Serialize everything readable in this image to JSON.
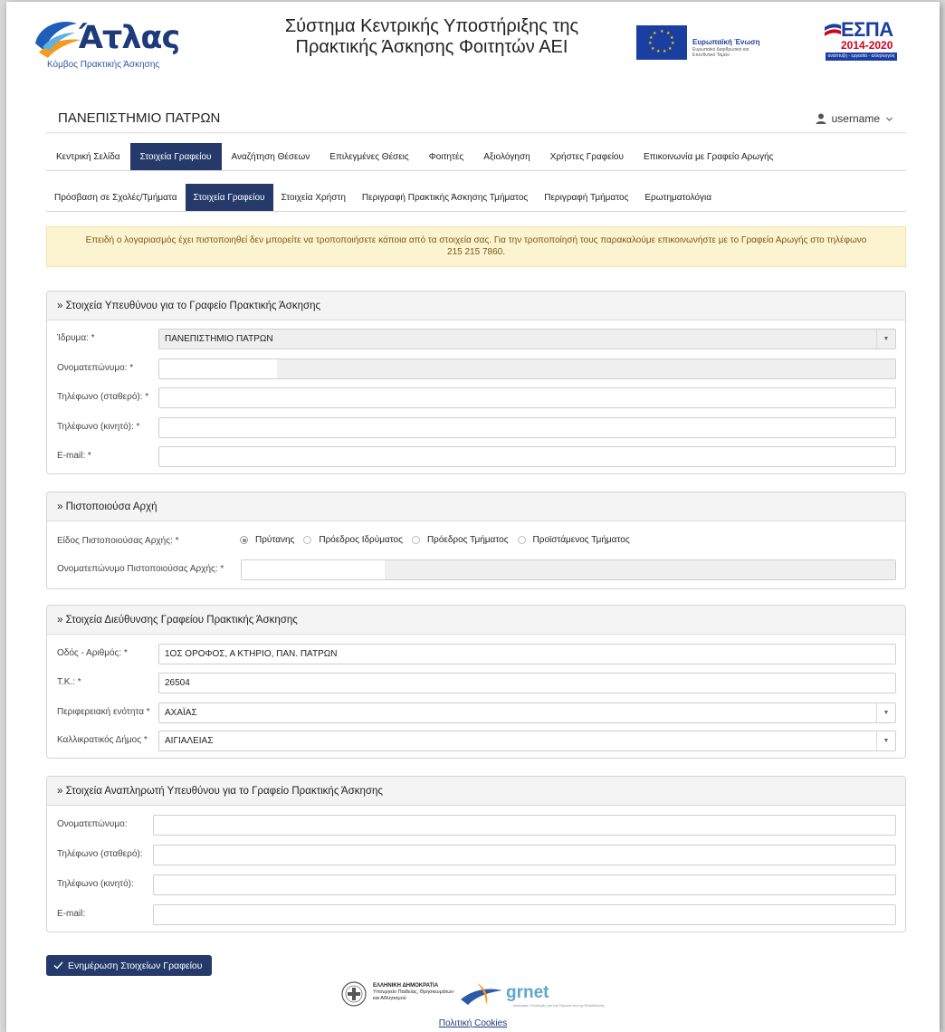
{
  "header": {
    "logo_title": "Άτλας",
    "logo_subtitle": "Κόμβος Πρακτικής Άσκησης",
    "system_title_line1": "Σύστημα Κεντρικής Υποστήριξης της",
    "system_title_line2": "Πρακτικής Άσκησης Φοιτητών ΑΕΙ",
    "eu_name": "Ευρωπαϊκή Ένωση",
    "eu_sub": "Ευρωπαϊκό Διαρθρωτικό και Επενδυτικό Ταμείο",
    "espa_title": "ΕΣΠΑ",
    "espa_years": "2014-2020",
    "espa_strip": "ανάπτυξη - εργασία - αλληλεγγύη"
  },
  "topbar": {
    "institution": "ΠΑΝΕΠΙΣΤΗΜΙΟ ΠΑΤΡΩΝ",
    "username": "username"
  },
  "nav_main": [
    {
      "label": "Κεντρική Σελίδα",
      "active": false
    },
    {
      "label": "Στοιχεία Γραφείου",
      "active": true
    },
    {
      "label": "Αναζήτηση Θέσεων",
      "active": false
    },
    {
      "label": "Επιλεγμένες Θέσεις",
      "active": false
    },
    {
      "label": "Φοιτητές",
      "active": false
    },
    {
      "label": "Αξιολόγηση",
      "active": false
    },
    {
      "label": "Χρήστες Γραφείου",
      "active": false
    },
    {
      "label": "Επικοινωνία με Γραφείο Αρωγής",
      "active": false
    }
  ],
  "nav_sub": [
    {
      "label": "Πρόσβαση σε Σχολές/Τμήματα",
      "active": false
    },
    {
      "label": "Στοιχεία Γραφείου",
      "active": true
    },
    {
      "label": "Στοιχεία Χρήστη",
      "active": false
    },
    {
      "label": "Περιγραφή Πρακτικής Άσκησης Τμήματος",
      "active": false
    },
    {
      "label": "Περιγραφή Τμήματος",
      "active": false
    },
    {
      "label": "Ερωτηματολόγια",
      "active": false
    }
  ],
  "alert": {
    "text": "Επειδή ο λογαριασμός έχει πιστοποιηθεί δεν μπορείτε να τροποποιήσετε κάποια από τα στοιχεία σας. Για την τροποποίησή τους παρακαλούμε επικοινωνήστε με το Γραφείο Αρωγής στο τηλέφωνο 215 215 7860."
  },
  "panel_responsible": {
    "title": "» Στοιχεία Υπευθύνου για το Γραφείο Πρακτικής Άσκησης",
    "institution_label": "Ίδρυμα: *",
    "institution_value": "ΠΑΝΕΠΙΣΤΗΜΙΟ ΠΑΤΡΩΝ",
    "fullname_label": "Ονοματεπώνυμο: *",
    "fullname_value": "",
    "phone_fixed_label": "Τηλέφωνο (σταθερό): *",
    "phone_fixed_value": "",
    "phone_mobile_label": "Τηλέφωνο (κινητό): *",
    "phone_mobile_value": "",
    "email_label": "E-mail: *",
    "email_value": ""
  },
  "panel_authority": {
    "title": "» Πιστοποιούσα Αρχή",
    "type_label": "Είδος Πιστοποιούσας Αρχής: *",
    "options": [
      {
        "label": "Πρύτανης",
        "selected": true
      },
      {
        "label": "Πρόεδρος Ιδρύματος",
        "selected": false
      },
      {
        "label": "Πρόεδρος Τμήματος",
        "selected": false
      },
      {
        "label": "Προϊστάμενος Τμήματος",
        "selected": false
      }
    ],
    "name_label": "Ονοματεπώνυμο Πιστοποιούσας Αρχής: *",
    "name_value": ""
  },
  "panel_address": {
    "title": "» Στοιχεία Διεύθυνσης Γραφείου Πρακτικής Άσκησης",
    "street_label": "Οδός - Αριθμός: *",
    "street_value": "1ΟΣ ΟΡΟΦΟΣ, Α ΚΤΗΡΙΟ, ΠΑΝ. ΠΑΤΡΩΝ",
    "zip_label": "Τ.Κ.: *",
    "zip_value": "26504",
    "region_label": "Περιφερειακή ενότητα *",
    "region_value": "ΑΧΑΪΑΣ",
    "municipality_label": "Καλλικρατικός Δήμος *",
    "municipality_value": "ΑΙΓΙΑΛΕΙΑΣ"
  },
  "panel_deputy": {
    "title": "» Στοιχεία Αναπληρωτή Υπευθύνου για το Γραφείο Πρακτικής Άσκησης",
    "fullname_label": "Ονοματεπώνυμο:",
    "phone_fixed_label": "Τηλέφωνο (σταθερό):",
    "phone_mobile_label": "Τηλέφωνο (κινητό):",
    "email_label": "E-mail:"
  },
  "actions": {
    "submit_label": "Ενημέρωση Στοιχείων Γραφείου"
  },
  "footer": {
    "gov_line1": "ΕΛΛΗΝΙΚΗ ΔΗΜΟΚΡΑΤΙΑ",
    "gov_line2": "Υπουργείο Παιδείας, Θρησκευμάτων και Αθλητισμού",
    "grnet": "grnet",
    "grnet_sub": "Δικτυακές Υποδομές για την Έρευνα και την Εκπαίδευση",
    "cookies_link": "Πολιτική Cookies"
  },
  "colors": {
    "nav_active_bg": "#253a6b",
    "alert_bg": "#fcf3d1",
    "brand_blue": "#1d3a7a"
  },
  "icons": {
    "user": "user-icon",
    "chevron": "chevron-down-icon",
    "check": "check-icon",
    "dropdown": "caret-down-icon"
  }
}
